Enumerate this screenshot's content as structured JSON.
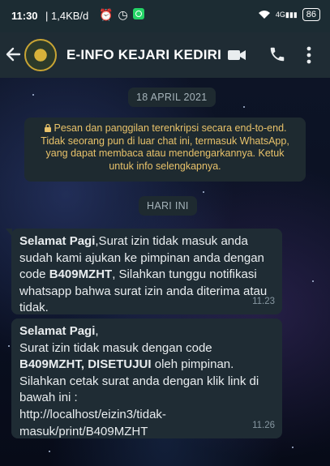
{
  "status_bar": {
    "time": "11:30",
    "network_speed": "1,4KB/d",
    "battery": "86",
    "signal": "4G"
  },
  "header": {
    "contact_name": "E-INFO KEJARI KEDIRI",
    "icons": [
      "back-arrow-icon",
      "avatar",
      "video-call-icon",
      "voice-call-icon",
      "more-options-icon"
    ]
  },
  "chat": {
    "date_label": "18 APRIL 2021",
    "encryption_notice": "Pesan dan panggilan terenkripsi secara end-to-end. Tidak seorang pun di luar chat ini, termasuk WhatsApp, yang dapat membaca atau mendengarkannya. Ketuk untuk info selengkapnya.",
    "today_label": "HARI INI",
    "messages": [
      {
        "greeting": "Selamat Pagi",
        "part1": ",Surat izin tidak masuk anda sudah kami ajukan ke pimpinan anda dengan code ",
        "code": "B409MZHT",
        "part2": ", Silahkan tunggu notifikasi whatsapp bahwa surat izin anda diterima atau tidak.",
        "time": "11.23"
      },
      {
        "greeting": "Selamat Pagi",
        "part1": ",\nSurat izin tidak masuk dengan code\n",
        "code": "B409MZHT",
        "sep": ", ",
        "status": "DISETUJUI",
        "part2": " oleh pimpinan.\nSilahkan cetak surat anda dengan klik link di bawah ini :\nhttp://localhost/eizin3/tidak-masuk/print/B409MZHT",
        "time": "11.26"
      }
    ]
  },
  "colors": {
    "header_bg": "#1f2c34",
    "bubble_bg": "#1f2c34",
    "notice_text": "#e8c26a",
    "timestamp": "#8696a0"
  }
}
